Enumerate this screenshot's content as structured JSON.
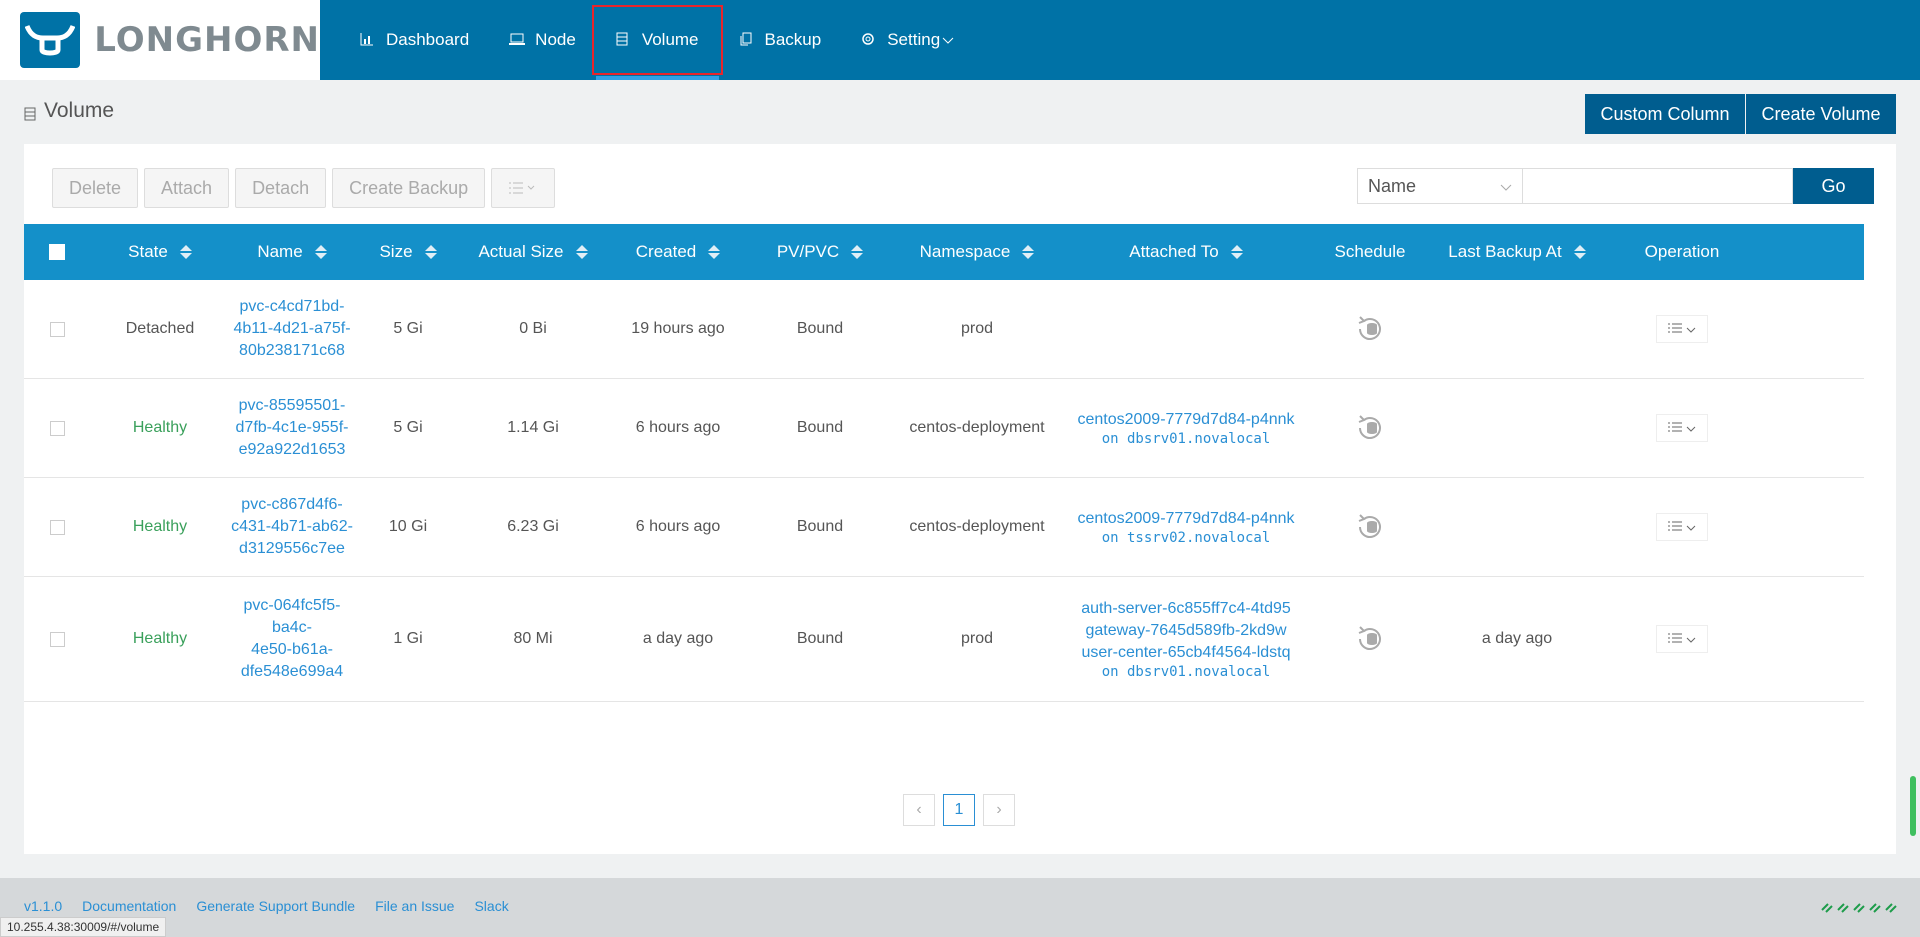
{
  "brand": {
    "name": "LONGHORN"
  },
  "nav": [
    {
      "label": "Dashboard",
      "icon": "chart-icon"
    },
    {
      "label": "Node",
      "icon": "laptop-icon"
    },
    {
      "label": "Volume",
      "icon": "volume-icon",
      "active": true
    },
    {
      "label": "Backup",
      "icon": "copy-icon"
    },
    {
      "label": "Setting",
      "icon": "gear-icon"
    }
  ],
  "page": {
    "title": "Volume"
  },
  "buttons": {
    "custom_column": "Custom Column",
    "create_volume": "Create Volume"
  },
  "actions": {
    "delete": "Delete",
    "attach": "Attach",
    "detach": "Detach",
    "create_backup": "Create Backup"
  },
  "search": {
    "field": "Name",
    "value": "",
    "go": "Go"
  },
  "table": {
    "columns": [
      "State",
      "Name",
      "Size",
      "Actual Size",
      "Created",
      "PV/PVC",
      "Namespace",
      "Attached To",
      "Schedule",
      "Last Backup At",
      "Operation"
    ],
    "rows": [
      {
        "state": "Detached",
        "name_lines": [
          "pvc-c4cd71bd-",
          "4b11-4d21-a75f-",
          "80b238171c68"
        ],
        "size": "5 Gi",
        "actual": "0 Bi",
        "created": "19 hours ago",
        "pvc": "Bound",
        "namespace": "prod",
        "attached": [],
        "node": "",
        "last_backup": ""
      },
      {
        "state": "Healthy",
        "name_lines": [
          "pvc-85595501-",
          "d7fb-4c1e-955f-",
          "e92a922d1653"
        ],
        "size": "5 Gi",
        "actual": "1.14 Gi",
        "created": "6 hours ago",
        "pvc": "Bound",
        "namespace": "centos-deployment",
        "attached": [
          "centos2009-7779d7d84-p4nnk"
        ],
        "node": "on dbsrv01.novalocal",
        "last_backup": ""
      },
      {
        "state": "Healthy",
        "name_lines": [
          "pvc-c867d4f6-",
          "c431-4b71-ab62-",
          "d3129556c7ee"
        ],
        "size": "10 Gi",
        "actual": "6.23 Gi",
        "created": "6 hours ago",
        "pvc": "Bound",
        "namespace": "centos-deployment",
        "attached": [
          "centos2009-7779d7d84-p4nnk"
        ],
        "node": "on tssrv02.novalocal",
        "last_backup": ""
      },
      {
        "state": "Healthy",
        "name_lines": [
          "pvc-064fc5f5-ba4c-",
          "4e50-b61a-",
          "dfe548e699a4"
        ],
        "size": "1 Gi",
        "actual": "80 Mi",
        "created": "a day ago",
        "pvc": "Bound",
        "namespace": "prod",
        "attached": [
          "auth-server-6c855ff7c4-4td95",
          "gateway-7645d589fb-2kd9w",
          "user-center-65cb4f4564-ldstq"
        ],
        "node": "on dbsrv01.novalocal",
        "last_backup": "a day ago"
      }
    ]
  },
  "pagination": {
    "current": "1"
  },
  "footer": {
    "links": [
      "v1.1.0",
      "Documentation",
      "Generate Support Bundle",
      "File an Issue",
      "Slack"
    ]
  },
  "status_url": "10.255.4.38:30009/#/volume",
  "colors": {
    "header": "#0072a6",
    "table_header": "#1490c9",
    "primary_button": "#005d8f",
    "healthy": "#3aa05b",
    "link": "#2a8fd4"
  }
}
